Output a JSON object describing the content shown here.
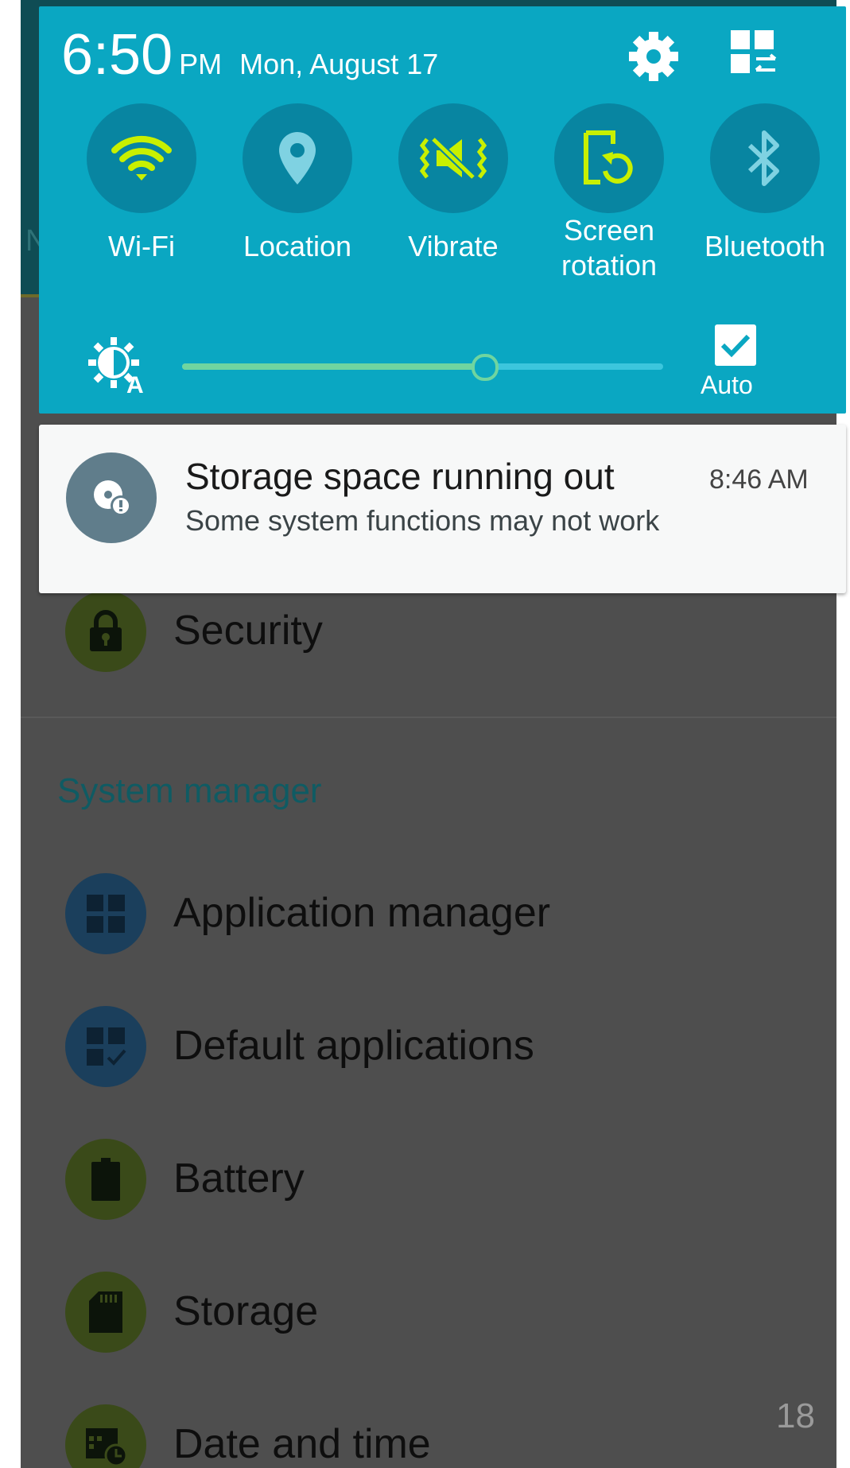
{
  "status": {
    "time": "6:50",
    "ampm": "PM",
    "date": "Mon, August 17",
    "settings_icon": "gear-icon",
    "edit_icon": "grid-edit-icon"
  },
  "quick_settings": [
    {
      "label": "Wi-Fi",
      "icon": "wifi-icon",
      "active": true
    },
    {
      "label": "Location",
      "icon": "location-pin-icon",
      "active": false
    },
    {
      "label": "Vibrate",
      "icon": "vibrate-icon",
      "active": true
    },
    {
      "label": "Screen\nrotation",
      "icon": "screen-rotation-icon",
      "active": true
    },
    {
      "label": "Bluetooth",
      "icon": "bluetooth-icon",
      "active": false
    }
  ],
  "brightness": {
    "icon": "auto-brightness-icon",
    "level": 0.63,
    "auto_label": "Auto",
    "auto_checked": true
  },
  "notification": {
    "icon": "storage-warning-icon",
    "title": "Storage space running out",
    "time": "8:46 AM",
    "text": "Some system functions may not work"
  },
  "background": {
    "rows_top": [
      {
        "label": "Security",
        "icon": "lock-icon"
      }
    ],
    "section_title": "System manager",
    "rows": [
      {
        "label": "Application manager",
        "icon": "apps-grid-icon"
      },
      {
        "label": "Default applications",
        "icon": "default-apps-icon"
      },
      {
        "label": "Battery",
        "icon": "battery-icon"
      },
      {
        "label": "Storage",
        "icon": "sd-card-icon"
      },
      {
        "label": "Date and time",
        "icon": "calendar-clock-icon"
      }
    ],
    "page_number": "18"
  },
  "colors": {
    "panel": "#0aa7c2",
    "button": "#0885a1",
    "active_icon": "#c8f000",
    "inactive_icon": "#7fd2e2",
    "dim_background": "#4e4e4e"
  }
}
